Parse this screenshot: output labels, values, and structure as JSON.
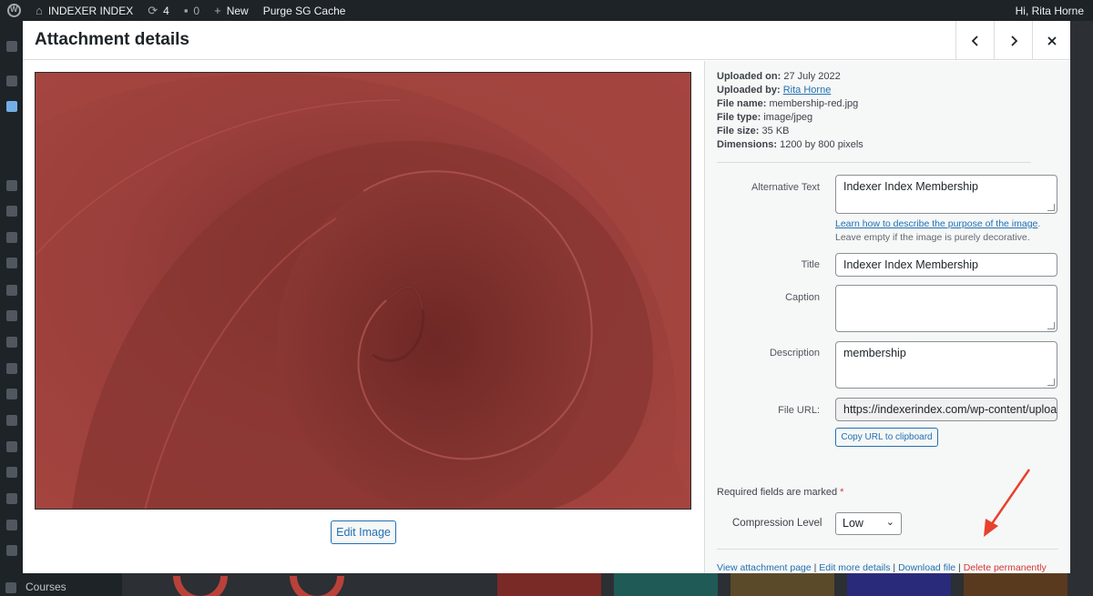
{
  "admin_bar": {
    "site_name": "INDEXER INDEX",
    "updates_count": "4",
    "comments_count": "0",
    "new_label": "New",
    "purge_label": "Purge SG Cache",
    "greeting": "Hi, Rita Horne"
  },
  "underlying": {
    "courses_label": "Courses"
  },
  "modal": {
    "title": "Attachment details",
    "edit_image_label": "Edit Image",
    "meta": {
      "uploaded_on_label": "Uploaded on:",
      "uploaded_on": "27 July 2022",
      "uploaded_by_label": "Uploaded by:",
      "uploaded_by": "Rita Horne",
      "file_name_label": "File name:",
      "file_name": "membership-red.jpg",
      "file_type_label": "File type:",
      "file_type": "image/jpeg",
      "file_size_label": "File size:",
      "file_size": "35 KB",
      "dimensions_label": "Dimensions:",
      "dimensions": "1200 by 800 pixels"
    },
    "fields": {
      "alt_label": "Alternative Text",
      "alt_value": "Indexer Index Membership",
      "alt_help_link": "Learn how to describe the purpose of the image",
      "alt_help_text": "Leave empty if the image is purely decorative.",
      "title_label": "Title",
      "title_value": "Indexer Index Membership",
      "caption_label": "Caption",
      "caption_value": "",
      "description_label": "Description",
      "description_value": "membership",
      "file_url_label": "File URL:",
      "file_url_value": "https://indexerindex.com/wp-content/uploa",
      "copy_url_label": "Copy URL to clipboard"
    },
    "required_text": "Required fields are marked",
    "required_star": "*",
    "compression_label": "Compression Level",
    "compression_value": "Low",
    "actions": {
      "view": "View attachment page",
      "edit_more": "Edit more details",
      "download": "Download file",
      "delete": "Delete permanently",
      "separator": "|"
    }
  },
  "colors": {
    "accent": "#2271b1",
    "danger": "#d63638",
    "image_tone": "#8f3a36"
  }
}
